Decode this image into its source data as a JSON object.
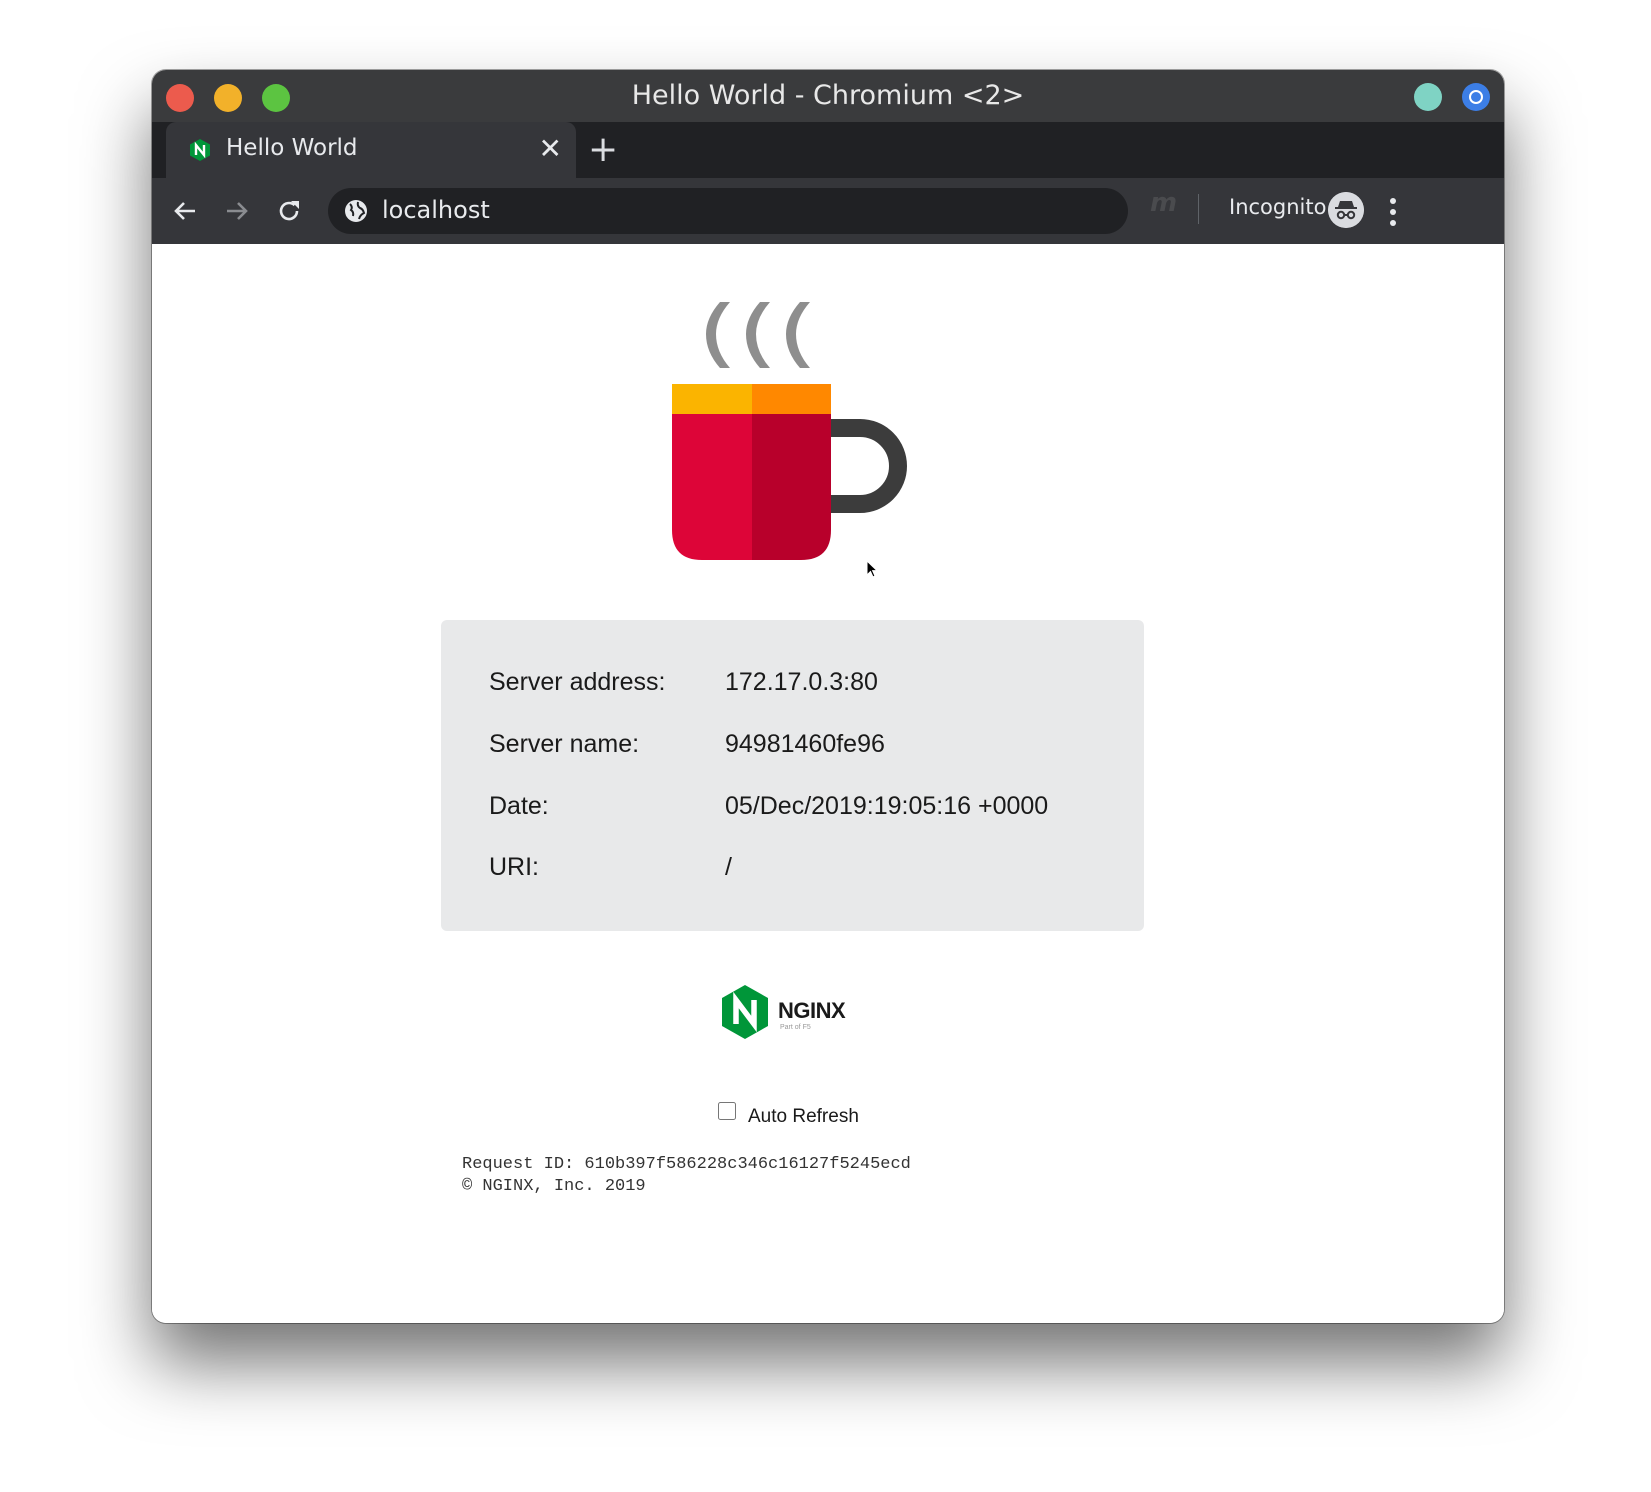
{
  "window": {
    "title": "Hello World - Chromium <2>"
  },
  "tab": {
    "title": "Hello World",
    "close_glyph": "✕",
    "favicon": "nginx-n-icon"
  },
  "new_tab_glyph": "+",
  "toolbar": {
    "url": "localhost",
    "extension_glyph": "m",
    "incognito_label": "Incognito"
  },
  "info": {
    "rows": [
      {
        "label": "Server address:",
        "value": "172.17.0.3:80"
      },
      {
        "label": "Server name:",
        "value": "94981460fe96"
      },
      {
        "label": "Date:",
        "value": "05/Dec/2019:19:05:16 +0000"
      },
      {
        "label": "URI:",
        "value": "/"
      }
    ]
  },
  "logo": {
    "wordmark": "NGINX",
    "tagline": "Part of F5",
    "brand_color": "#009639"
  },
  "auto_refresh": {
    "label": "Auto Refresh",
    "checked": false
  },
  "footer": {
    "request_id": "Request ID: 610b397f586228c346c16127f5245ecd",
    "copyright": "© NGINX, Inc. 2019"
  }
}
